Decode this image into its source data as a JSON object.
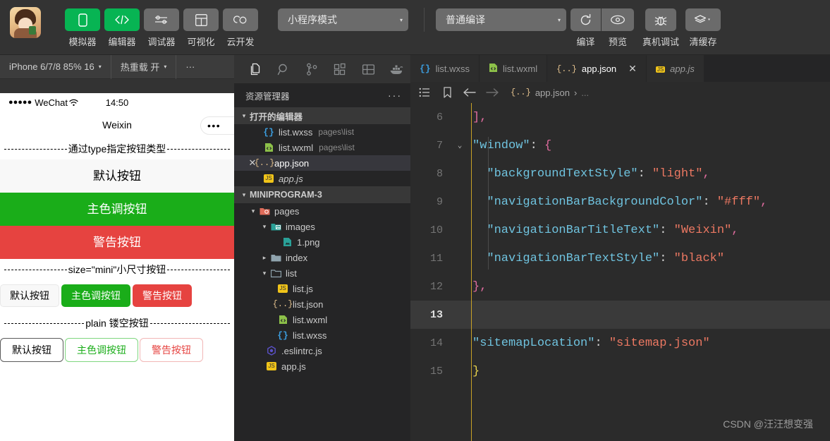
{
  "toolbar": {
    "panel_buttons": [
      {
        "label": "模拟器",
        "icon": "phone-icon",
        "active": true
      },
      {
        "label": "编辑器",
        "icon": "code-icon",
        "active": true
      },
      {
        "label": "调试器",
        "icon": "sliders-icon",
        "active": false
      },
      {
        "label": "可视化",
        "icon": "layout-icon",
        "active": false
      },
      {
        "label": "云开发",
        "icon": "cloud-icon",
        "active": false
      }
    ],
    "mode_select": {
      "value": "小程序模式",
      "caret": "▾"
    },
    "compile_select": {
      "value": "普通编译",
      "caret": "▾"
    },
    "action_buttons": [
      {
        "label": "编译",
        "icon": "refresh-icon"
      },
      {
        "label": "预览",
        "icon": "eye-icon"
      },
      {
        "label": "真机调试",
        "icon": "bug-icon"
      },
      {
        "label": "清缓存",
        "icon": "layers-icon"
      }
    ]
  },
  "simulator": {
    "device_bar": {
      "device": "iPhone 6/7/8 85% 16",
      "hot_reload": "热重载 开",
      "more": "···"
    },
    "status": {
      "signal_dots": "●●●●●",
      "carrier": "WeChat",
      "time": "14:50"
    },
    "nav": {
      "title": "Weixin",
      "capsule_dots": "•••"
    },
    "sections": [
      {
        "title": "通过type指定按钮类型"
      },
      {
        "title": "size=\"mini\"小尺寸按钮"
      },
      {
        "title": "plain 镂空按钮"
      }
    ],
    "block_buttons": [
      {
        "label": "默认按钮",
        "kind": "default"
      },
      {
        "label": "主色调按钮",
        "kind": "primary"
      },
      {
        "label": "警告按钮",
        "kind": "warn"
      }
    ],
    "mini_buttons": [
      {
        "label": "默认按钮",
        "kind": "default"
      },
      {
        "label": "主色调按钮",
        "kind": "primary"
      },
      {
        "label": "警告按钮",
        "kind": "warn"
      }
    ],
    "plain_buttons": [
      {
        "label": "默认按钮",
        "kind": "default"
      },
      {
        "label": "主色调按钮",
        "kind": "primary"
      },
      {
        "label": "警告按钮",
        "kind": "warn"
      }
    ]
  },
  "activity_bar": {
    "icons": [
      {
        "name": "files-icon",
        "active": true
      },
      {
        "name": "search-icon",
        "active": false
      },
      {
        "name": "source-control-icon",
        "active": false
      },
      {
        "name": "extensions-icon",
        "active": false
      },
      {
        "name": "layout-panel-icon",
        "active": false
      },
      {
        "name": "docker-icon",
        "active": false
      }
    ]
  },
  "explorer": {
    "title": "资源管理器",
    "more": "···",
    "open_editors": {
      "label": "打开的编辑器",
      "twisty": "▾",
      "items": [
        {
          "name": "list.wxss",
          "path": "pages\\list",
          "icon": "wxss-icon",
          "selected": false,
          "italic": false,
          "close": false
        },
        {
          "name": "list.wxml",
          "path": "pages\\list",
          "icon": "wxml-icon",
          "selected": false,
          "italic": false,
          "close": false
        },
        {
          "name": "app.json",
          "path": "",
          "icon": "json-icon",
          "selected": true,
          "italic": false,
          "close": true
        },
        {
          "name": "app.js",
          "path": "",
          "icon": "js-icon",
          "selected": false,
          "italic": true,
          "close": false
        }
      ]
    },
    "project": {
      "label": "MINIPROGRAM-3",
      "twisty": "▾",
      "items": [
        {
          "name": "pages",
          "icon": "folder-open-red-icon",
          "twisty": "▾",
          "indent": 1,
          "type": "folder"
        },
        {
          "name": "images",
          "icon": "folder-open-green-icon",
          "twisty": "▾",
          "indent": 2,
          "type": "folder"
        },
        {
          "name": "1.png",
          "icon": "image-icon",
          "twisty": "",
          "indent": 3,
          "type": "file"
        },
        {
          "name": "index",
          "icon": "folder-icon",
          "twisty": "▸",
          "indent": 2,
          "type": "folder"
        },
        {
          "name": "list",
          "icon": "folder-open-icon",
          "twisty": "▾",
          "indent": 2,
          "type": "folder"
        },
        {
          "name": "list.js",
          "icon": "js-icon",
          "twisty": "",
          "indent": 3,
          "type": "file"
        },
        {
          "name": "list.json",
          "icon": "json-icon",
          "twisty": "",
          "indent": 3,
          "type": "file"
        },
        {
          "name": "list.wxml",
          "icon": "wxml-icon",
          "twisty": "",
          "indent": 3,
          "type": "file"
        },
        {
          "name": "list.wxss",
          "icon": "wxss-icon",
          "twisty": "",
          "indent": 3,
          "type": "file"
        },
        {
          "name": ".eslintrc.js",
          "icon": "eslint-icon",
          "twisty": "",
          "indent": 2,
          "type": "file"
        },
        {
          "name": "app.js",
          "icon": "js-icon",
          "twisty": "",
          "indent": 2,
          "type": "file"
        }
      ]
    }
  },
  "editor": {
    "tabs": [
      {
        "label": "list.wxss",
        "icon": "wxss-icon",
        "active": false,
        "italic": false,
        "closeable": false
      },
      {
        "label": "list.wxml",
        "icon": "wxml-icon",
        "active": false,
        "italic": false,
        "closeable": false
      },
      {
        "label": "app.json",
        "icon": "json-icon",
        "active": true,
        "italic": false,
        "closeable": true,
        "close": "✕"
      },
      {
        "label": "app.js",
        "icon": "js-icon",
        "active": false,
        "italic": true,
        "closeable": false
      }
    ],
    "breadcrumb": {
      "icons": [
        "outline-icon",
        "bookmark-icon",
        "arrow-left-icon",
        "arrow-right-icon"
      ],
      "file": "app.json",
      "separator": "›",
      "tail": "..."
    },
    "lines": [
      {
        "num": "6",
        "fold": "",
        "highlight": false,
        "tokens": [
          {
            "t": "],",
            "c": "k-brace"
          }
        ]
      },
      {
        "num": "7",
        "fold": "⌄",
        "highlight": false,
        "tokens": [
          {
            "t": "\"window\"",
            "c": "k-key"
          },
          {
            "t": ": ",
            "c": "k-plain"
          },
          {
            "t": "{",
            "c": "k-brace"
          }
        ]
      },
      {
        "num": "8",
        "fold": "",
        "highlight": false,
        "tokens": [
          {
            "t": "  \"backgroundTextStyle\"",
            "c": "k-key"
          },
          {
            "t": ": ",
            "c": "k-plain"
          },
          {
            "t": "\"light\"",
            "c": "k-str"
          },
          {
            "t": ",",
            "c": "k-brace"
          }
        ]
      },
      {
        "num": "9",
        "fold": "",
        "highlight": false,
        "tokens": [
          {
            "t": "  \"navigationBarBackgroundColor\"",
            "c": "k-key"
          },
          {
            "t": ": ",
            "c": "k-plain"
          },
          {
            "t": "\"#fff\"",
            "c": "k-str"
          },
          {
            "t": ",",
            "c": "k-brace"
          }
        ]
      },
      {
        "num": "10",
        "fold": "",
        "highlight": false,
        "tokens": [
          {
            "t": "  \"navigationBarTitleText\"",
            "c": "k-key"
          },
          {
            "t": ": ",
            "c": "k-plain"
          },
          {
            "t": "\"Weixin\"",
            "c": "k-str"
          },
          {
            "t": ",",
            "c": "k-brace"
          }
        ]
      },
      {
        "num": "11",
        "fold": "",
        "highlight": false,
        "tokens": [
          {
            "t": "  \"navigationBarTextStyle\"",
            "c": "k-key"
          },
          {
            "t": ": ",
            "c": "k-plain"
          },
          {
            "t": "\"black\"",
            "c": "k-str"
          }
        ]
      },
      {
        "num": "12",
        "fold": "",
        "highlight": false,
        "tokens": [
          {
            "t": "},",
            "c": "k-brace"
          }
        ]
      },
      {
        "num": "13",
        "fold": "",
        "highlight": true,
        "tokens": [
          {
            "t": "",
            "c": "k-plain"
          }
        ]
      },
      {
        "num": "14",
        "fold": "",
        "highlight": false,
        "tokens": [
          {
            "t": "\"sitemapLocation\"",
            "c": "k-key"
          },
          {
            "t": ": ",
            "c": "k-plain"
          },
          {
            "t": "\"sitemap.json\"",
            "c": "k-str"
          }
        ]
      },
      {
        "num": "15",
        "fold": "",
        "highlight": false,
        "tokens": [
          {
            "t": "}",
            "c": "k-yellow"
          }
        ]
      }
    ]
  },
  "watermark": "CSDN @汪汪想变强",
  "colors": {
    "accent_green": "#07b453",
    "btn_primary": "#1aad19",
    "btn_warn": "#e64340",
    "toolbar_bg": "#333333",
    "explorer_bg": "#252526",
    "editor_bg": "#2b2b2b"
  }
}
